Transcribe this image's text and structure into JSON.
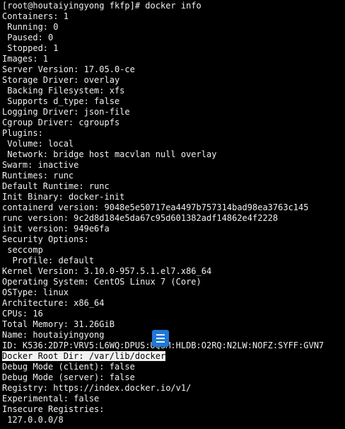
{
  "terminal": {
    "lines": [
      "[root@houtaiyingyong fkfp]# docker info",
      "Containers: 1",
      " Running: 0",
      " Paused: 0",
      " Stopped: 1",
      "Images: 1",
      "Server Version: 17.05.0-ce",
      "Storage Driver: overlay",
      " Backing Filesystem: xfs",
      " Supports d_type: false",
      "Logging Driver: json-file",
      "Cgroup Driver: cgroupfs",
      "Plugins:",
      " Volume: local",
      " Network: bridge host macvlan null overlay",
      "Swarm: inactive",
      "Runtimes: runc",
      "Default Runtime: runc",
      "Init Binary: docker-init",
      "containerd version: 9048e5e50717ea4497b757314bad98ea3763c145",
      "runc version: 9c2d8d184e5da67c95d601382adf14862e4f2228",
      "init version: 949e6fa",
      "Security Options:",
      " seccomp",
      "  Profile: default",
      "Kernel Version: 3.10.0-957.5.1.el7.x86_64",
      "Operating System: CentOS Linux 7 (Core)",
      "OSType: linux",
      "Architecture: x86_64",
      "CPUs: 16",
      "Total Memory: 31.26GiB",
      "Name: houtaiyingyong",
      "ID: K536:2D7P:VRV5:L6WQ:DPUS:UQSM:HLDB:O2RQ:N2LW:NOFZ:SYFF:GVN7",
      "Docker Root Dir: /var/lib/docker",
      "Debug Mode (client): false",
      "Debug Mode (server): false",
      "Registry: https://index.docker.io/v1/",
      "Experimental: false",
      "Insecure Registries:",
      " 127.0.0.0/8"
    ],
    "highlight_index": 33,
    "background_color": "#000000",
    "text_color": "#f0f0f0",
    "highlight_color": "#f2f2f2"
  },
  "overlay_icon": {
    "name": "list-icon",
    "color": "#1f78d8"
  }
}
